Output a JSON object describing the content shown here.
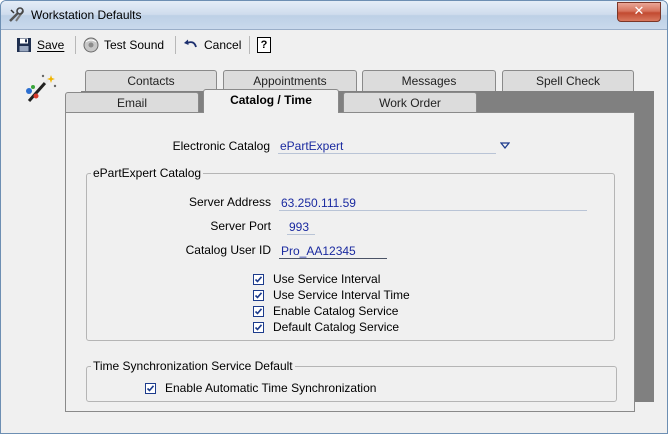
{
  "window": {
    "title": "Workstation Defaults",
    "close_glyph": "✕"
  },
  "toolbar": {
    "save_label": "Save",
    "test_sound_label": "Test Sound",
    "cancel_label": "Cancel",
    "help_glyph": "?"
  },
  "tabs": {
    "back_row": [
      "Contacts",
      "Appointments",
      "Messages",
      "Spell Check"
    ],
    "front_row": [
      "Email",
      "Catalog / Time",
      "Work Order"
    ],
    "active": "Catalog / Time"
  },
  "catalog": {
    "electronic_catalog_label": "Electronic Catalog",
    "electronic_catalog_value": "ePartExpert",
    "group_title": "ePartExpert Catalog",
    "server_address_label": "Server Address",
    "server_address_value": "63.250.111.59",
    "server_port_label": "Server Port",
    "server_port_value": "993",
    "user_id_label": "Catalog User ID",
    "user_id_value": "Pro_AA12345",
    "options": [
      {
        "label": "Use Service Interval",
        "checked": true
      },
      {
        "label": "Use Service Interval Time",
        "checked": true
      },
      {
        "label": "Enable Catalog Service",
        "checked": true
      },
      {
        "label": "Default Catalog Service",
        "checked": true
      }
    ]
  },
  "time_sync": {
    "group_title": "Time Synchronization Service Default",
    "option_label": "Enable Automatic Time Synchronization",
    "checked": true
  },
  "colors": {
    "value_text": "#1a2aa0",
    "checkbox_border": "#1c3b8c",
    "close_button": "#c24a31"
  }
}
